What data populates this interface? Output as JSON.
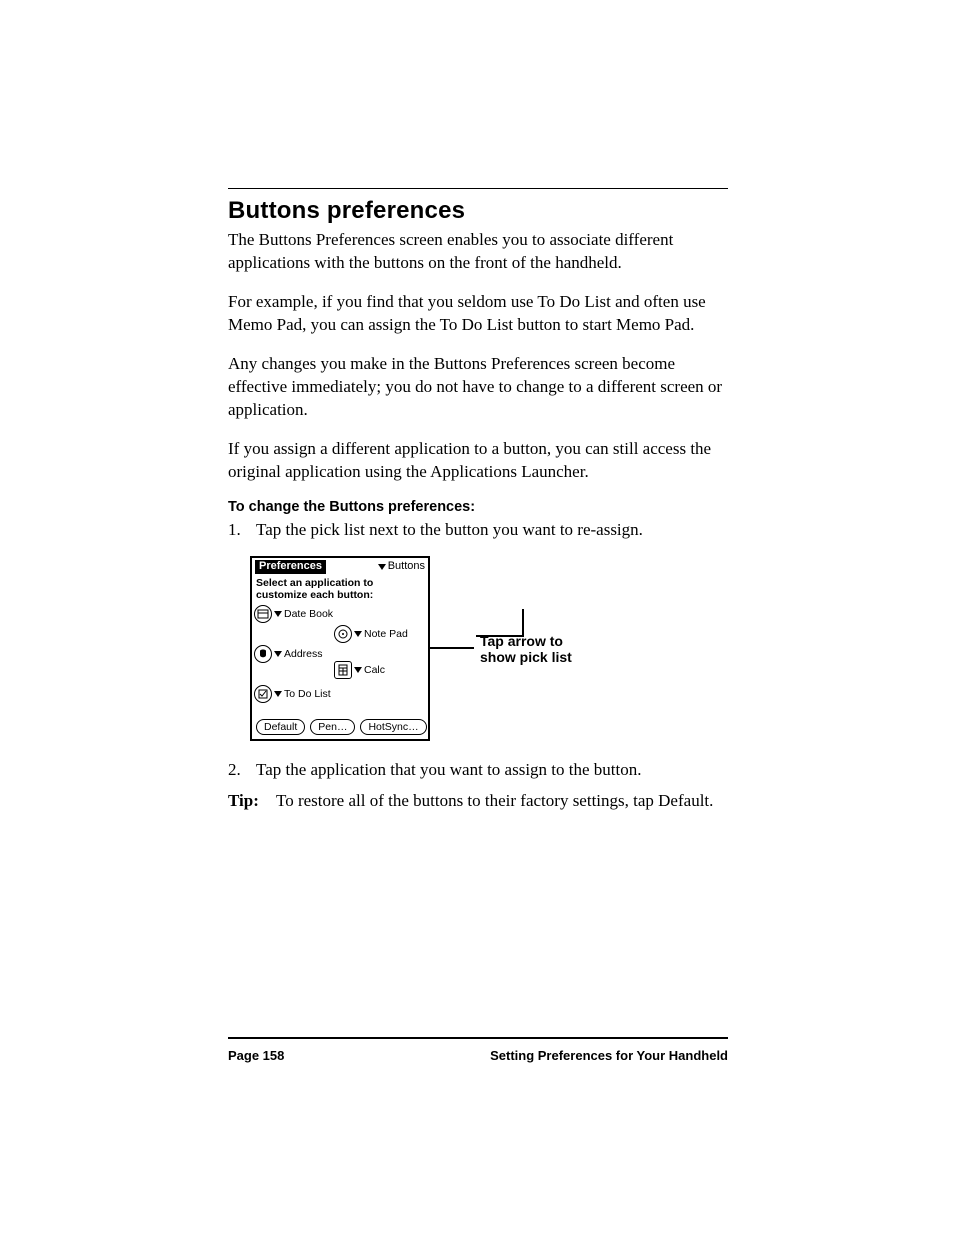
{
  "heading": "Buttons preferences",
  "paras": [
    "The Buttons Preferences screen enables you to associate different applications with the buttons on the front of the handheld.",
    "For example, if you find that you seldom use To Do List and often use Memo Pad, you can assign the To Do List button to start Memo Pad.",
    "Any changes you make in the Buttons Preferences screen become effective immediately; you do not have to change to a different screen or application.",
    "If you assign a different application to a button, you can still access the original application using the Applications Launcher."
  ],
  "subhead": "To change the Buttons preferences:",
  "step1_num": "1.",
  "step1_text": "Tap the pick list next to the button you want to re-assign.",
  "step2_num": "2.",
  "step2_text": "Tap the application that you want to assign to the button.",
  "tip_label": "Tip:",
  "tip_text": "To restore all of the buttons to their factory settings, tap Default.",
  "device": {
    "title": "Preferences",
    "category": "Buttons",
    "prompt": "Select an application to customize each button:",
    "assignments": {
      "datebook": "Date Book",
      "notepad": "Note Pad",
      "address": "Address",
      "calc": "Calc",
      "todo": "To Do List"
    },
    "buttons": {
      "default": "Default",
      "pen": "Pen…",
      "hotsync": "HotSync…"
    }
  },
  "callout_line1": "Tap arrow to",
  "callout_line2": "show pick list",
  "footer": {
    "page": "Page 158",
    "chapter": "Setting Preferences for Your Handheld"
  }
}
